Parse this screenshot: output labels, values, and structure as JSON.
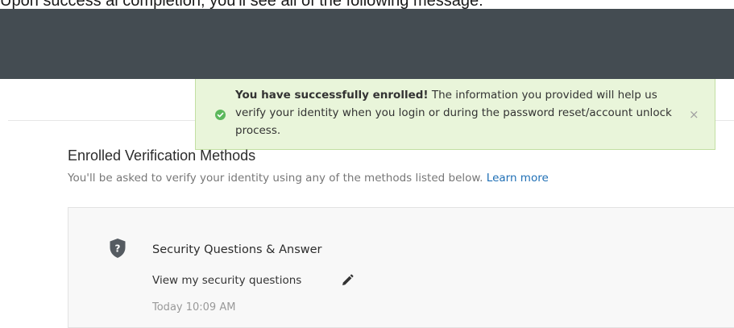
{
  "page": {
    "top_caption": "Upon success al completion, you'll see all of the following message:"
  },
  "toast": {
    "bold_text": "You have successfully enrolled!",
    "message": " The information you provided will help us verify your identity when you login or during the password reset/account unlock process.",
    "close_glyph": "×",
    "icon": "check-circle-icon",
    "color_bg": "#e9f5da",
    "color_icon": "#5cb85c"
  },
  "enrolled": {
    "title": "Enrolled Verification Methods",
    "subtitle": "You'll be asked to verify your identity using any of the methods listed below.",
    "learn_more": "Learn more"
  },
  "method": {
    "icon": "shield-question-icon",
    "name": "Security Questions & Answer",
    "view_link": "View my security questions",
    "edit_icon": "pencil-icon",
    "timestamp": "Today 10:09 AM"
  },
  "colors": {
    "header_bar": "#444c52",
    "link": "#1f6fb5"
  }
}
